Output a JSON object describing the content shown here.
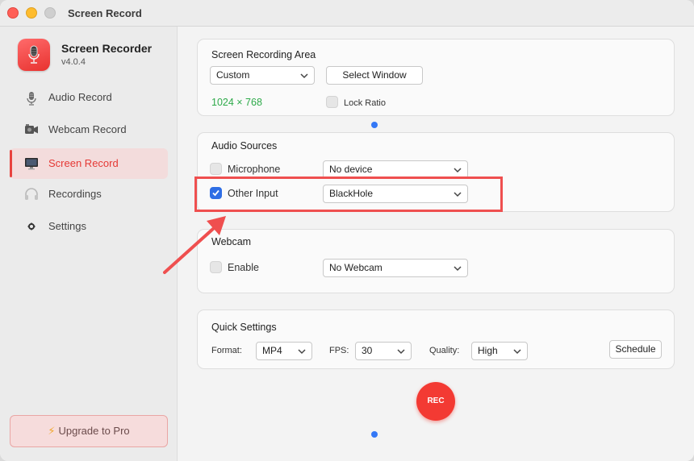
{
  "window": {
    "title": "Screen Record"
  },
  "app": {
    "name": "Screen Recorder",
    "version": "v4.0.4"
  },
  "sidebar": {
    "items": [
      {
        "label": "Audio Record",
        "icon": "microphone-icon"
      },
      {
        "label": "Webcam Record",
        "icon": "webcam-icon"
      },
      {
        "label": "Screen Record",
        "icon": "monitor-icon",
        "active": true
      },
      {
        "label": "Recordings",
        "icon": "headphones-icon"
      },
      {
        "label": "Settings",
        "icon": "gear-icon"
      }
    ],
    "upgrade_label": "Upgrade to Pro"
  },
  "recording_area": {
    "title": "Screen Recording Area",
    "area_value": "Custom",
    "select_window_label": "Select Window",
    "resolution": "1024 × 768",
    "lock_ratio_label": "Lock Ratio",
    "lock_ratio_checked": false
  },
  "audio_sources": {
    "title": "Audio Sources",
    "microphone_label": "Microphone",
    "microphone_checked": false,
    "microphone_device": "No device",
    "other_input_label": "Other Input",
    "other_input_checked": true,
    "other_input_device": "BlackHole"
  },
  "webcam": {
    "title": "Webcam",
    "enable_label": "Enable",
    "enable_checked": false,
    "device": "No Webcam"
  },
  "quick_settings": {
    "title": "Quick Settings",
    "format_label": "Format:",
    "format_value": "MP4",
    "fps_label": "FPS:",
    "fps_value": "30",
    "quality_label": "Quality:",
    "quality_value": "High",
    "schedule_label": "Schedule"
  },
  "rec_label": "REC",
  "colors": {
    "accent": "#e8423e",
    "checkbox_checked": "#2f6ee5",
    "resolution_text": "#2eaa4a",
    "annotation": "#ef4f4f"
  }
}
